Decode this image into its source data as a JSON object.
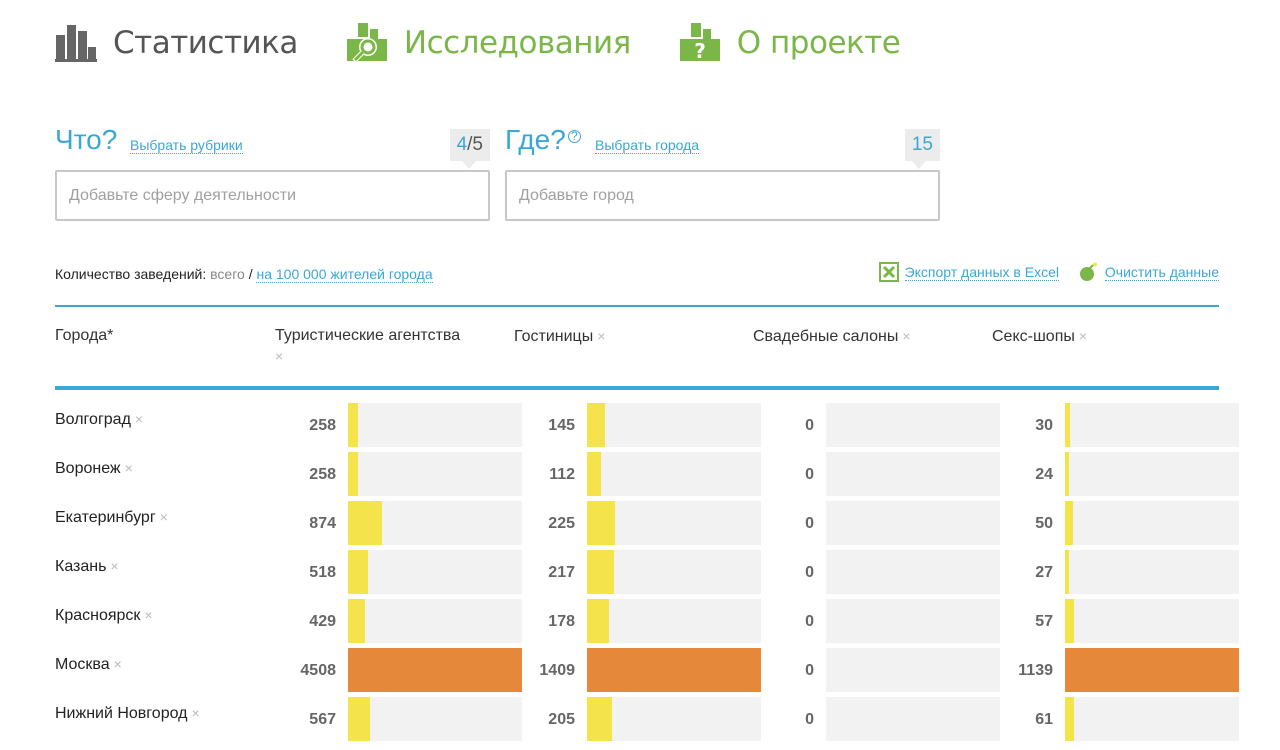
{
  "nav": [
    {
      "label": "Статистика",
      "icon": "bar-chart-icon",
      "state": "active"
    },
    {
      "label": "Исследования",
      "icon": "research-magnifier-icon",
      "state": "green"
    },
    {
      "label": "О проекте",
      "icon": "about-question-icon",
      "state": "green"
    }
  ],
  "what": {
    "title": "Что?",
    "choose_label": "Выбрать рубрики",
    "counter_current": "4",
    "counter_max": "/5",
    "placeholder": "Добавьте сферу деятельности"
  },
  "where": {
    "title": "Где?",
    "help_icon": "?",
    "choose_label": "Выбрать города",
    "counter": "15",
    "placeholder": "Добавьте город"
  },
  "toolbar": {
    "count_label": "Количество заведений:",
    "all_label": "всего",
    "separator": " / ",
    "per_capita_label": "на 100 000 жителей города",
    "export_label": "Экспорт данных в Excel",
    "clear_label": "Очистить данные"
  },
  "colors": {
    "accent": "#3aa7d9",
    "green": "#7ab648",
    "bar_normal": "#f4e34a",
    "bar_max": "#e5883a",
    "track": "#f2f2f2"
  },
  "table": {
    "city_header": "Города*",
    "remove_glyph": "×",
    "columns": [
      "Туристические агентства",
      "Гостиницы",
      "Свадебные салоны",
      "Секс-шопы"
    ],
    "rows": [
      {
        "city": "Волгоград",
        "values": [
          "258",
          "145",
          "0",
          "30"
        ],
        "fills": [
          0.057,
          0.103,
          0,
          0.026
        ],
        "max": [
          false,
          false,
          false,
          false
        ]
      },
      {
        "city": "Воронеж",
        "values": [
          "258",
          "112",
          "0",
          "24"
        ],
        "fills": [
          0.057,
          0.079,
          0,
          0.021
        ],
        "max": [
          false,
          false,
          false,
          false
        ]
      },
      {
        "city": "Екатеринбург",
        "values": [
          "874",
          "225",
          "0",
          "50"
        ],
        "fills": [
          0.194,
          0.16,
          0,
          0.044
        ],
        "max": [
          false,
          false,
          false,
          false
        ]
      },
      {
        "city": "Казань",
        "values": [
          "518",
          "217",
          "0",
          "27"
        ],
        "fills": [
          0.115,
          0.154,
          0,
          0.024
        ],
        "max": [
          false,
          false,
          false,
          false
        ]
      },
      {
        "city": "Красноярск",
        "values": [
          "429",
          "178",
          "0",
          "57"
        ],
        "fills": [
          0.095,
          0.126,
          0,
          0.05
        ],
        "max": [
          false,
          false,
          false,
          false
        ]
      },
      {
        "city": "Москва",
        "values": [
          "4508",
          "1409",
          "0",
          "1139"
        ],
        "fills": [
          1,
          1,
          0,
          1
        ],
        "max": [
          true,
          true,
          false,
          true
        ]
      },
      {
        "city": "Нижний Новгород",
        "values": [
          "567",
          "205",
          "0",
          "61"
        ],
        "fills": [
          0.126,
          0.145,
          0,
          0.054
        ],
        "max": [
          false,
          false,
          false,
          false
        ]
      }
    ]
  }
}
